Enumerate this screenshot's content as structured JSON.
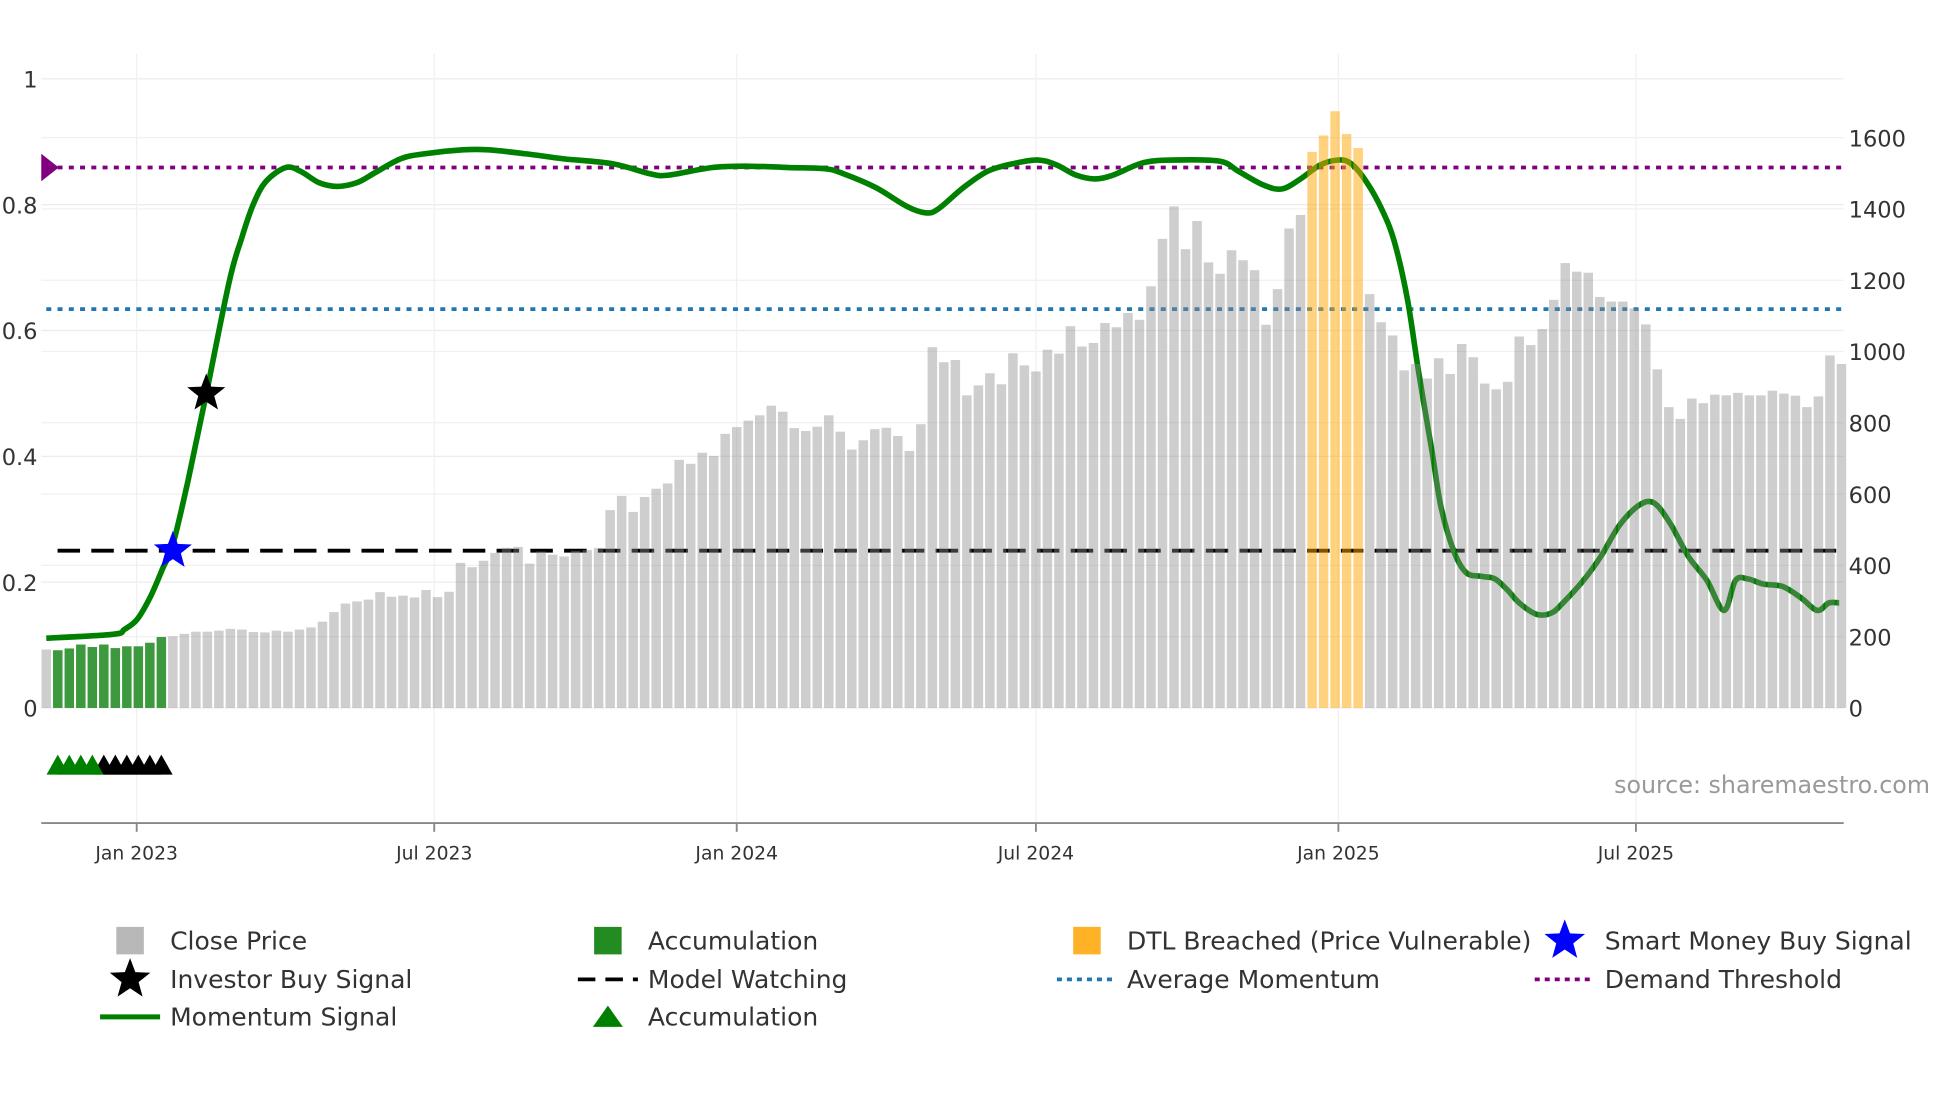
{
  "chart_data": {
    "type": "bar+line",
    "frequency": "weekly",
    "start_date": "2022-11-07",
    "close_price": [
      164,
      162,
      167,
      178,
      171,
      178,
      168,
      173,
      173,
      183,
      199,
      201,
      208,
      214,
      214,
      217,
      222,
      220,
      213,
      212,
      217,
      214,
      220,
      226,
      242,
      269,
      293,
      299,
      304,
      325,
      312,
      315,
      310,
      331,
      311,
      326,
      407,
      395,
      413,
      435,
      449,
      452,
      405,
      439,
      430,
      425,
      441,
      443,
      449,
      555,
      595,
      550,
      592,
      615,
      630,
      696,
      685,
      716,
      707,
      769,
      788,
      806,
      821,
      848,
      831,
      785,
      777,
      789,
      821,
      775,
      725,
      751,
      782,
      786,
      763,
      721,
      796,
      1012,
      970,
      976,
      877,
      905,
      939,
      908,
      995,
      961,
      944,
      1005,
      994,
      1071,
      1014,
      1024,
      1080,
      1068,
      1108,
      1089,
      1183,
      1316,
      1407,
      1287,
      1366,
      1250,
      1218,
      1284,
      1256,
      1228,
      1075,
      1175,
      1345,
      1383,
      1560,
      1606,
      1674,
      1610,
      1571,
      1161,
      1082,
      1045,
      947,
      965,
      924,
      981,
      937,
      1021,
      984,
      910,
      894,
      915,
      1042,
      1018,
      1063,
      1145,
      1248,
      1224,
      1221,
      1153,
      1140,
      1140,
      1121,
      1076,
      950,
      844,
      811,
      868,
      855,
      879,
      877,
      884,
      877,
      877,
      890,
      882,
      876,
      844,
      874,
      989,
      965
    ],
    "accumulation_weeks": [
      1,
      2,
      3,
      4,
      5,
      6,
      7,
      8,
      9,
      10
    ],
    "dtl_breached_weeks": [
      110,
      111,
      112,
      113,
      114
    ],
    "momentum_signal": [
      [
        0,
        0.111
      ],
      [
        5.8,
        0.117
      ],
      [
        6.8,
        0.125
      ],
      [
        7.9,
        0.141
      ],
      [
        9.0,
        0.175
      ],
      [
        10.1,
        0.221
      ],
      [
        11.0,
        0.26
      ],
      [
        12.3,
        0.36
      ],
      [
        13.9,
        0.499
      ],
      [
        15.9,
        0.678
      ],
      [
        17.0,
        0.748
      ],
      [
        18.0,
        0.801
      ],
      [
        19.1,
        0.837
      ],
      [
        20.8,
        0.859
      ],
      [
        22.1,
        0.853
      ],
      [
        23.7,
        0.835
      ],
      [
        25.3,
        0.829
      ],
      [
        27.0,
        0.835
      ],
      [
        28.6,
        0.851
      ],
      [
        30.8,
        0.873
      ],
      [
        32.9,
        0.881
      ],
      [
        36.2,
        0.887
      ],
      [
        38.4,
        0.887
      ],
      [
        41.6,
        0.881
      ],
      [
        44.9,
        0.873
      ],
      [
        49.2,
        0.865
      ],
      [
        52.5,
        0.849
      ],
      [
        54.1,
        0.847
      ],
      [
        57.9,
        0.859
      ],
      [
        61.2,
        0.861
      ],
      [
        64.5,
        0.859
      ],
      [
        67.7,
        0.857
      ],
      [
        69.3,
        0.849
      ],
      [
        72.1,
        0.827
      ],
      [
        74.8,
        0.797
      ],
      [
        76.4,
        0.787
      ],
      [
        77.5,
        0.793
      ],
      [
        79.7,
        0.827
      ],
      [
        81.8,
        0.853
      ],
      [
        84.0,
        0.865
      ],
      [
        86.2,
        0.871
      ],
      [
        87.8,
        0.863
      ],
      [
        89.5,
        0.847
      ],
      [
        91.1,
        0.841
      ],
      [
        92.7,
        0.847
      ],
      [
        95.4,
        0.867
      ],
      [
        98.2,
        0.871
      ],
      [
        102.0,
        0.869
      ],
      [
        103.6,
        0.853
      ],
      [
        105.8,
        0.831
      ],
      [
        107.4,
        0.825
      ],
      [
        109.0,
        0.841
      ],
      [
        110.7,
        0.863
      ],
      [
        112.3,
        0.871
      ],
      [
        113.4,
        0.865
      ],
      [
        114.7,
        0.837
      ],
      [
        116.1,
        0.791
      ],
      [
        117.2,
        0.738
      ],
      [
        118.3,
        0.648
      ],
      [
        119.3,
        0.529
      ],
      [
        120.4,
        0.41
      ],
      [
        121.2,
        0.32
      ],
      [
        122.3,
        0.25
      ],
      [
        123.4,
        0.215
      ],
      [
        124.8,
        0.209
      ],
      [
        125.9,
        0.205
      ],
      [
        127.0,
        0.187
      ],
      [
        128.0,
        0.167
      ],
      [
        129.5,
        0.149
      ],
      [
        130.8,
        0.151
      ],
      [
        131.8,
        0.167
      ],
      [
        133.5,
        0.201
      ],
      [
        135.1,
        0.241
      ],
      [
        136.7,
        0.29
      ],
      [
        138.4,
        0.322
      ],
      [
        139.7,
        0.326
      ],
      [
        141.1,
        0.294
      ],
      [
        142.7,
        0.241
      ],
      [
        144.3,
        0.203
      ],
      [
        145.8,
        0.155
      ],
      [
        146.8,
        0.203
      ],
      [
        147.9,
        0.205
      ],
      [
        149.2,
        0.197
      ],
      [
        150.9,
        0.193
      ],
      [
        152.5,
        0.175
      ],
      [
        153.9,
        0.155
      ],
      [
        154.9,
        0.167
      ],
      [
        155.8,
        0.167
      ]
    ],
    "demand_threshold": 0.859,
    "average_momentum": 0.634,
    "model_watching": 0.25,
    "smart_money_buy_signal": {
      "week": 11,
      "value": 0.25
    },
    "investor_buy_signal": {
      "week": 13.9,
      "value": 0.5
    },
    "accumulation_markers": {
      "value": -0.09,
      "green_weeks": [
        1,
        2,
        3,
        4
      ],
      "black_weeks": [
        5,
        6,
        7,
        8,
        9,
        10
      ]
    },
    "left_axis": {
      "range": [
        -0.183,
        1.04
      ],
      "ticks": [
        0,
        0.2,
        0.4,
        0.6,
        0.8,
        1
      ],
      "tick_labels": [
        "0",
        "0.2",
        "0.4",
        "0.6",
        "0.8",
        "1"
      ]
    },
    "right_axis": {
      "range": [
        -323,
        1836
      ],
      "ticks": [
        0,
        200,
        400,
        600,
        800,
        1000,
        1200,
        1400,
        1600
      ],
      "tick_labels": [
        "0",
        "200",
        "400",
        "600",
        "800",
        "1000",
        "1200",
        "1400",
        "1600"
      ]
    },
    "x_axis": {
      "ticks": [
        "2023-01-01",
        "2023-07-01",
        "2024-01-01",
        "2024-07-01",
        "2025-01-01",
        "2025-07-01"
      ],
      "tick_labels": [
        "Jan 2023",
        "Jul 2023",
        "Jan 2024",
        "Jul 2024",
        "Jan 2025",
        "Jul 2025"
      ]
    },
    "grid": true,
    "legend_position": "bottom",
    "legend": [
      {
        "label": "Close Price",
        "symbol": "square",
        "color": "#b8b8b8"
      },
      {
        "label": "Investor Buy Signal",
        "symbol": "star",
        "color": "#000000"
      },
      {
        "label": "Momentum Signal",
        "symbol": "line",
        "color": "#008000"
      },
      {
        "label": "Accumulation",
        "symbol": "square",
        "color": "#228b22"
      },
      {
        "label": "Model Watching",
        "symbol": "dash",
        "color": "#000000"
      },
      {
        "label": "Accumulation",
        "symbol": "triangle",
        "color": "#008000"
      },
      {
        "label": "DTL Breached (Price Vulnerable)",
        "symbol": "square",
        "color": "#ffa500"
      },
      {
        "label": "Average Momentum",
        "symbol": "dot",
        "color": "#1f77b4"
      },
      {
        "label": "Smart Money Buy Signal",
        "symbol": "star",
        "color": "#0000ff"
      },
      {
        "label": "Demand Threshold",
        "symbol": "dot",
        "color": "#800080"
      }
    ],
    "source": "source: sharemaestro.com"
  },
  "colors": {
    "bar": "#8a8a8a",
    "accum_bar": "#228b22",
    "dtl_bar": "#ffa500",
    "momentum": "#008000",
    "avg": "#1f77b4",
    "threshold": "#800080",
    "watch": "#000000",
    "smart_star": "#0000ff",
    "investor_star": "#000000"
  }
}
